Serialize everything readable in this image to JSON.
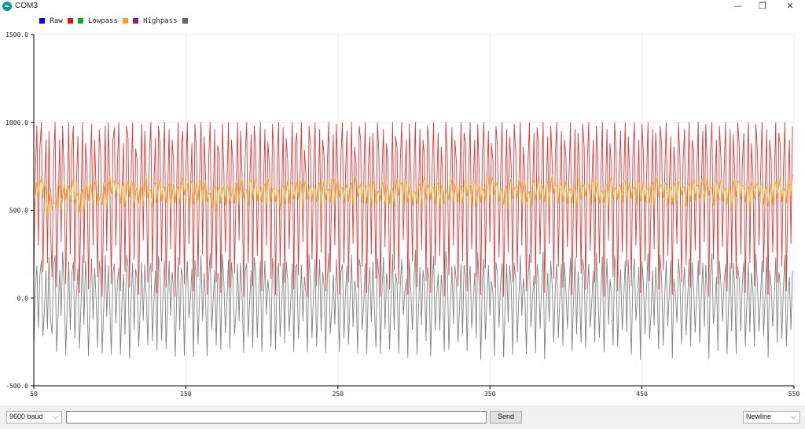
{
  "window": {
    "title": "COM3",
    "minimize": "—",
    "maximize": "❐",
    "close": "✕",
    "app_icon": "arduino-icon"
  },
  "legend": [
    {
      "label": "Raw",
      "color": "#0000dd"
    },
    {
      "label": "Lowpass",
      "color": "#dd1111"
    },
    {
      "label": "Highpass",
      "color": "#f5a020"
    },
    {
      "label": "",
      "color": "#8a1e8a"
    }
  ],
  "extra_swatches": [
    "#20a020",
    "#666666"
  ],
  "chart_data": {
    "type": "line",
    "title": "",
    "xlabel": "",
    "ylabel": "",
    "xlim": [
      50,
      550
    ],
    "ylim": [
      -500,
      1500
    ],
    "x_ticks": [
      "50",
      "150",
      "250",
      "350",
      "450",
      "550"
    ],
    "y_ticks": [
      "1500.0",
      "1000.0",
      "500.0",
      "0.0",
      "-500.0"
    ],
    "x_tick_values": [
      50,
      150,
      250,
      350,
      450,
      550
    ],
    "y_tick_values": [
      1500,
      1000,
      500,
      0,
      -500
    ],
    "grid": true,
    "legend_position": "top-left",
    "series": [
      {
        "name": "Lowpass",
        "color": "#dd3a3a",
        "kind": "noisy",
        "values": [
          100,
          700,
          980,
          300,
          850,
          1000,
          150,
          600,
          900,
          200,
          950,
          400,
          120,
          780,
          1000,
          60,
          500,
          900,
          320,
          980,
          700,
          80,
          600,
          1000,
          250,
          840,
          980,
          100,
          650,
          920,
          30,
          520,
          1000,
          200,
          880,
          760,
          50,
          710,
          990,
          300,
          900,
          600,
          120,
          960,
          820,
          10,
          560,
          980,
          270,
          1000,
          650,
          80,
          900,
          970,
          300,
          760,
          1000,
          40,
          620,
          880,
          150,
          980,
          910,
          60,
          700,
          1000,
          220,
          850,
          780,
          20,
          600,
          990,
          330,
          950,
          680,
          90,
          800,
          1000,
          150,
          640,
          910,
          30,
          980,
          880,
          210,
          720,
          1000,
          60,
          570,
          960,
          280,
          900,
          770,
          10,
          650,
          1000,
          190,
          860,
          950,
          80,
          720,
          1000,
          310,
          600,
          880,
          40,
          990,
          830,
          120,
          680,
          1000,
          250,
          920,
          700,
          20,
          780,
          1000,
          170,
          550,
          960,
          90,
          870,
          810,
          30,
          990,
          720,
          260,
          640,
          1000,
          60,
          900,
          760,
          140,
          580,
          1000,
          330,
          950,
          690,
          10,
          800,
          1000,
          200,
          660,
          930,
          70,
          980,
          850,
          240,
          700,
          1000,
          40,
          600,
          960,
          300,
          890,
          740,
          110,
          990,
          820,
          20,
          720,
          1000,
          180,
          560,
          970,
          90,
          910,
          780,
          280,
          660,
          1000,
          50,
          880,
          940,
          130,
          620,
          1000,
          320,
          840,
          700,
          10,
          980,
          870,
          220,
          720,
          1000,
          70,
          590,
          960,
          260,
          900,
          800,
          40,
          760,
          1000,
          150,
          640,
          930,
          300,
          990,
          680,
          20,
          820,
          1000,
          200,
          700,
          950,
          90,
          600,
          1000,
          310,
          860,
          760,
          60,
          980,
          900,
          180,
          660,
          1000,
          30,
          740,
          920,
          250,
          940,
          640,
          110,
          1000,
          820,
          10,
          700,
          960,
          290,
          880,
          780,
          50,
          600,
          1000,
          160,
          920,
          850,
          80,
          760,
          1000,
          330,
          650,
          900,
          20,
          990,
          720,
          210,
          700,
          1000,
          60,
          560,
          960,
          270,
          900,
          800,
          100,
          980,
          870,
          30,
          740,
          1000,
          190,
          620,
          940,
          240,
          860,
          700,
          10,
          1000,
          820,
          130,
          680,
          970,
          300,
          900,
          760,
          70,
          600,
          1000,
          210,
          940,
          880,
          40,
          720,
          1000,
          280,
          640,
          900,
          120,
          990,
          700,
          20,
          800,
          1000,
          170,
          660,
          950,
          320,
          880,
          780,
          60,
          980,
          860,
          230,
          700,
          1000,
          10,
          560,
          960,
          260,
          920,
          740,
          90,
          990,
          820,
          150,
          640,
          1000,
          300,
          860,
          700,
          40,
          760,
          1000,
          200,
          600,
          940,
          80,
          970,
          880,
          250,
          700,
          1000,
          30,
          620,
          920,
          310,
          980,
          760,
          110,
          820,
          1000,
          180,
          660,
          950,
          60,
          900,
          800,
          290,
          700,
          1000,
          20,
          580,
          960,
          230,
          940,
          720,
          140,
          990,
          860,
          50,
          760,
          1000,
          270,
          640,
          900,
          90,
          980,
          780,
          200,
          700,
          1000,
          10,
          600,
          960,
          330,
          880,
          740,
          120,
          1000,
          840,
          40,
          720,
          950,
          260,
          660,
          1000,
          180,
          920,
          700,
          70,
          800,
          1000,
          300,
          620,
          900,
          30,
          990,
          820,
          210,
          680,
          1000,
          100,
          560,
          960,
          280,
          940,
          760,
          50,
          980,
          870,
          160,
          700,
          1000,
          240,
          640,
          920,
          20,
          860,
          720,
          310,
          1000,
          800,
          90,
          760,
          960,
          190,
          600,
          1000,
          60,
          900,
          840,
          270,
          700,
          1000,
          130,
          620,
          950,
          320,
          990,
          740,
          10,
          820,
          1000,
          220,
          660,
          900,
          80,
          980,
          780,
          290,
          700,
          1000,
          40,
          580,
          960,
          170,
          930,
          720,
          110,
          1000,
          860,
          250,
          760,
          940,
          30,
          640,
          1000,
          200,
          880,
          700,
          70,
          990,
          820,
          300,
          700,
          1000,
          150,
          600,
          960,
          20,
          900,
          780,
          260,
          660,
          1000,
          90,
          940,
          860,
          180,
          720,
          1000,
          40,
          620,
          900,
          310,
          980,
          740,
          120,
          800,
          1000,
          230,
          680,
          950,
          60,
          870,
          720,
          280,
          990,
          820,
          10,
          760,
          1000,
          190,
          640,
          930,
          100,
          900,
          780,
          320,
          700,
          1000,
          50,
          600,
          500
        ]
      },
      {
        "name": "Highpass",
        "color": "#f5a623",
        "kind": "smooth",
        "values": []
      },
      {
        "name": "",
        "color": "#808080",
        "kind": "noisy",
        "values": []
      }
    ]
  },
  "footer": {
    "baud_value": "9600 baud",
    "message_value": "",
    "send_label": "Send",
    "line_ending_value": "Newline",
    "dropdown_icon": "chevron-down-icon"
  }
}
